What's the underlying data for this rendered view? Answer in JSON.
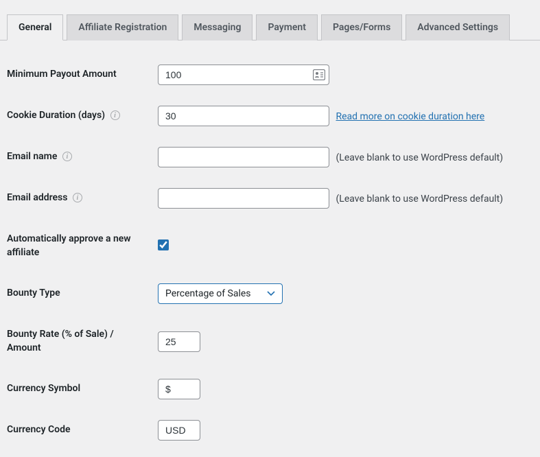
{
  "tabs": {
    "general": "General",
    "affiliate_registration": "Affiliate Registration",
    "messaging": "Messaging",
    "payment": "Payment",
    "pages_forms": "Pages/Forms",
    "advanced_settings": "Advanced Settings"
  },
  "labels": {
    "min_payout": "Minimum Payout Amount",
    "cookie_duration": "Cookie Duration (days)",
    "email_name": "Email name",
    "email_address": "Email address",
    "auto_approve": "Automatically approve a new affiliate",
    "bounty_type": "Bounty Type",
    "bounty_rate": "Bounty Rate (% of Sale) / Amount",
    "currency_symbol": "Currency Symbol",
    "currency_code": "Currency Code"
  },
  "values": {
    "min_payout": "100",
    "cookie_duration": "30",
    "email_name": "",
    "email_address": "",
    "auto_approve": true,
    "bounty_type": "Percentage of Sales",
    "bounty_rate": "25",
    "currency_symbol": "$",
    "currency_code": "USD"
  },
  "hints": {
    "cookie_link": "Read more on cookie duration here",
    "email_default": "(Leave blank to use WordPress default)"
  }
}
